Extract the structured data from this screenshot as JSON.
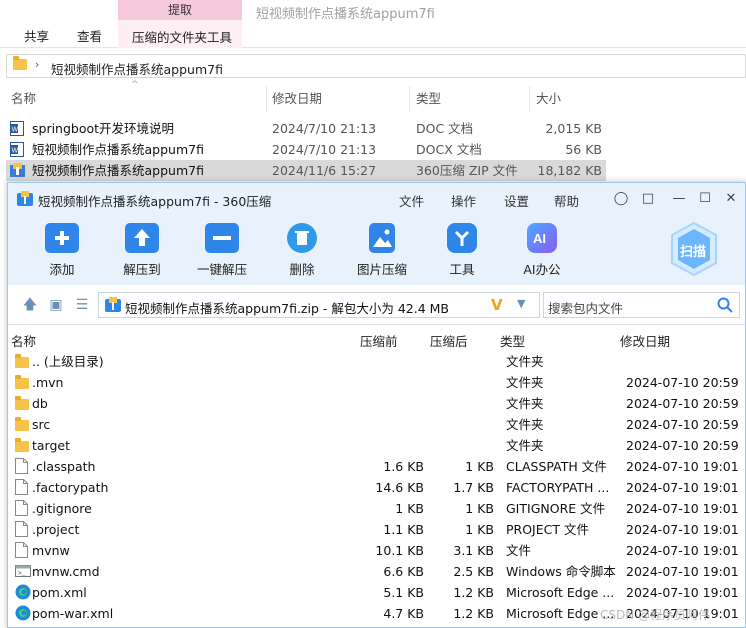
{
  "explorer": {
    "context_tab": "提取",
    "context_subtab": "压缩的文件夹工具",
    "window_title": "短视频制作点播系统appum7fi",
    "ribbon_tabs": [
      "共享",
      "查看"
    ],
    "breadcrumb": "短视频制作点播系统appum7fi",
    "columns": {
      "name": "名称",
      "date": "修改日期",
      "type": "类型",
      "size": "大小"
    },
    "files": [
      {
        "name": "springboot开发环境说明",
        "date": "2024/7/10 21:13",
        "type": "DOC 文档",
        "size": "2,015 KB",
        "icon": "word-doc-icon"
      },
      {
        "name": "短视频制作点播系统appum7fi",
        "date": "2024/7/10 21:13",
        "type": "DOCX 文档",
        "size": "56 KB",
        "icon": "word-docx-icon"
      },
      {
        "name": "短视频制作点播系统appum7fi",
        "date": "2024/11/6 15:27",
        "type": "360压缩 ZIP 文件",
        "size": "18,182 KB",
        "icon": "zip-archive-icon"
      }
    ]
  },
  "zip": {
    "title": "短视频制作点播系统appum7fi - 360压缩",
    "menu": [
      "文件",
      "操作",
      "设置",
      "帮助"
    ],
    "toolbar": [
      "添加",
      "解压到",
      "一键解压",
      "删除",
      "图片压缩",
      "工具",
      "AI办公"
    ],
    "scan_label": "扫描",
    "address": "短视频制作点播系统appum7fi.zip - 解包大小为 42.4 MB",
    "search_placeholder": "搜索包内文件",
    "columns": {
      "name": "名称",
      "before": "压缩前",
      "after": "压缩后",
      "type": "类型",
      "date": "修改日期"
    },
    "rows": [
      {
        "name": ".. (上级目录)",
        "before": "",
        "after": "",
        "type": "文件夹",
        "date": "",
        "icon": "folder"
      },
      {
        "name": ".mvn",
        "before": "",
        "after": "",
        "type": "文件夹",
        "date": "2024-07-10 20:59",
        "icon": "folder"
      },
      {
        "name": "db",
        "before": "",
        "after": "",
        "type": "文件夹",
        "date": "2024-07-10 20:59",
        "icon": "folder"
      },
      {
        "name": "src",
        "before": "",
        "after": "",
        "type": "文件夹",
        "date": "2024-07-10 20:59",
        "icon": "folder"
      },
      {
        "name": "target",
        "before": "",
        "after": "",
        "type": "文件夹",
        "date": "2024-07-10 20:59",
        "icon": "folder"
      },
      {
        "name": ".classpath",
        "before": "1.6 KB",
        "after": "1 KB",
        "type": "CLASSPATH 文件",
        "date": "2024-07-10 19:01",
        "icon": "file"
      },
      {
        "name": ".factorypath",
        "before": "14.6 KB",
        "after": "1.7 KB",
        "type": "FACTORYPATH ...",
        "date": "2024-07-10 19:01",
        "icon": "file"
      },
      {
        "name": ".gitignore",
        "before": "1 KB",
        "after": "1 KB",
        "type": "GITIGNORE 文件",
        "date": "2024-07-10 19:01",
        "icon": "file"
      },
      {
        "name": ".project",
        "before": "1.1 KB",
        "after": "1 KB",
        "type": "PROJECT 文件",
        "date": "2024-07-10 19:01",
        "icon": "file"
      },
      {
        "name": "mvnw",
        "before": "10.1 KB",
        "after": "3.1 KB",
        "type": "文件",
        "date": "2024-07-10 19:01",
        "icon": "file"
      },
      {
        "name": "mvnw.cmd",
        "before": "6.6 KB",
        "after": "2.5 KB",
        "type": "Windows 命令脚本",
        "date": "2024-07-10 19:01",
        "icon": "cmd"
      },
      {
        "name": "pom.xml",
        "before": "5.1 KB",
        "after": "1.2 KB",
        "type": "Microsoft Edge ...",
        "date": "2024-07-10 19:01",
        "icon": "edge"
      },
      {
        "name": "pom-war.xml",
        "before": "4.7 KB",
        "after": "1.2 KB",
        "type": "Microsoft Edge ...",
        "date": "2024-07-10 19:01",
        "icon": "edge"
      }
    ]
  },
  "watermark": "CSDN @程序员阿伟"
}
